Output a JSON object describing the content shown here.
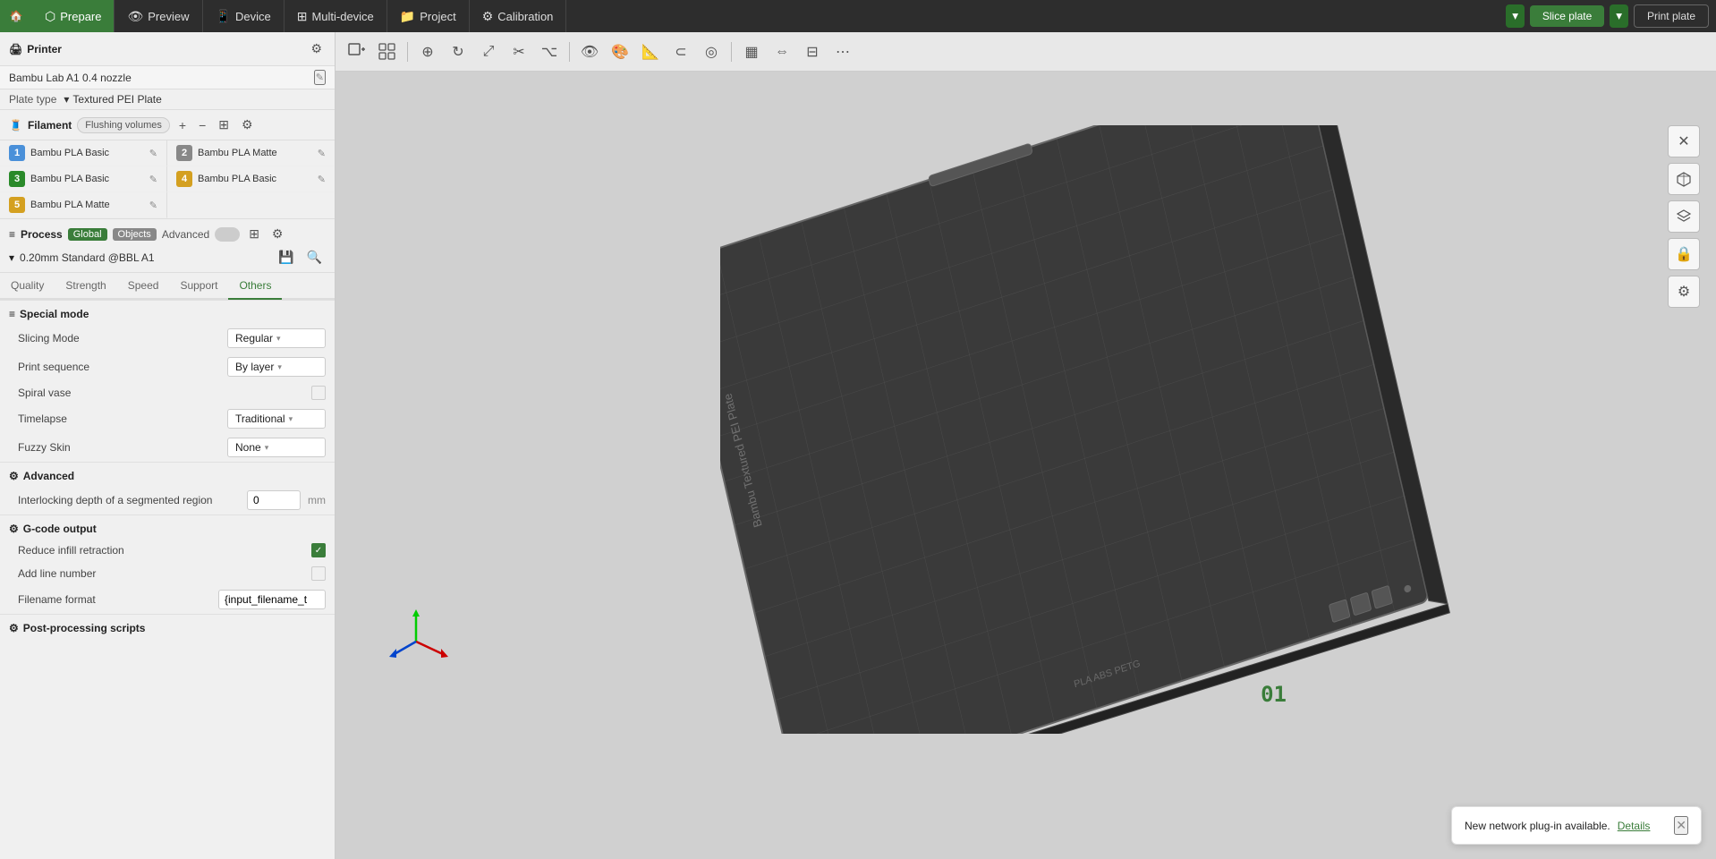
{
  "topNav": {
    "tabs": [
      {
        "id": "home",
        "label": "",
        "icon": "🏠",
        "active": false
      },
      {
        "id": "prepare",
        "label": "Prepare",
        "icon": "⬡",
        "active": true
      },
      {
        "id": "preview",
        "label": "Preview",
        "icon": "👁",
        "active": false
      },
      {
        "id": "device",
        "label": "Device",
        "icon": "📱",
        "active": false
      },
      {
        "id": "multi-device",
        "label": "Multi-device",
        "icon": "⊞",
        "active": false
      },
      {
        "id": "project",
        "label": "Project",
        "icon": "📁",
        "active": false
      },
      {
        "id": "calibration",
        "label": "Calibration",
        "icon": "⚙",
        "active": false
      }
    ],
    "sliceBtn": "Slice plate",
    "printBtn": "Print plate"
  },
  "leftPanel": {
    "printer": {
      "sectionTitle": "Printer",
      "printerName": "Bambu Lab A1 0.4 nozzle",
      "plateTypeLabel": "Plate type",
      "plateTypeValue": "Textured PEI Plate"
    },
    "filament": {
      "sectionTitle": "Filament",
      "flushingBtn": "Flushing volumes",
      "items": [
        {
          "id": 1,
          "badgeClass": "badge-1",
          "name": "Bambu PLA Basic"
        },
        {
          "id": 2,
          "badgeClass": "badge-2",
          "name": "Bambu PLA Matte"
        },
        {
          "id": 3,
          "badgeClass": "badge-3",
          "name": "Bambu PLA Basic"
        },
        {
          "id": 4,
          "badgeClass": "badge-4",
          "name": "Bambu PLA Basic"
        },
        {
          "id": 5,
          "badgeClass": "badge-5",
          "name": "Bambu PLA Matte"
        }
      ]
    },
    "process": {
      "sectionTitle": "Process",
      "tagGlobal": "Global",
      "tagObjects": "Objects",
      "advancedLabel": "Advanced",
      "presetValue": "0.20mm Standard @BBL A1",
      "tabs": [
        "Quality",
        "Strength",
        "Speed",
        "Support",
        "Others"
      ],
      "activeTab": "Others"
    },
    "settings": {
      "specialMode": {
        "groupTitle": "Special mode",
        "rows": [
          {
            "label": "Slicing Mode",
            "controlType": "dropdown",
            "value": "Regular"
          },
          {
            "label": "Print sequence",
            "controlType": "dropdown",
            "value": "By layer"
          },
          {
            "label": "Spiral vase",
            "controlType": "checkbox",
            "checked": false
          },
          {
            "label": "Timelapse",
            "controlType": "dropdown",
            "value": "Traditional"
          },
          {
            "label": "Fuzzy Skin",
            "controlType": "dropdown",
            "value": "None"
          }
        ]
      },
      "advanced": {
        "groupTitle": "Advanced",
        "rows": [
          {
            "label": "Interlocking depth of a segmented region",
            "controlType": "number",
            "value": "0",
            "unit": "mm"
          }
        ]
      },
      "gcodeOutput": {
        "groupTitle": "G-code output",
        "rows": [
          {
            "label": "Reduce infill retraction",
            "controlType": "checkbox",
            "checked": true
          },
          {
            "label": "Add line number",
            "controlType": "checkbox",
            "checked": false
          },
          {
            "label": "Filename format",
            "controlType": "text",
            "value": "{input_filename_t"
          }
        ]
      },
      "postProcessing": {
        "groupTitle": "Post-processing scripts"
      }
    }
  },
  "notification": {
    "text": "New network plug-in available.",
    "linkText": "Details"
  },
  "label01": "01",
  "icons": {
    "home": "🏠",
    "gear": "⚙",
    "edit": "✎",
    "plus": "+",
    "minus": "−",
    "search": "🔍",
    "chevronDown": "▾",
    "close": "✕",
    "check": "✓",
    "expand": "⊞",
    "layers": "≡",
    "lock": "🔒",
    "cog": "⚙",
    "move": "⊕"
  }
}
